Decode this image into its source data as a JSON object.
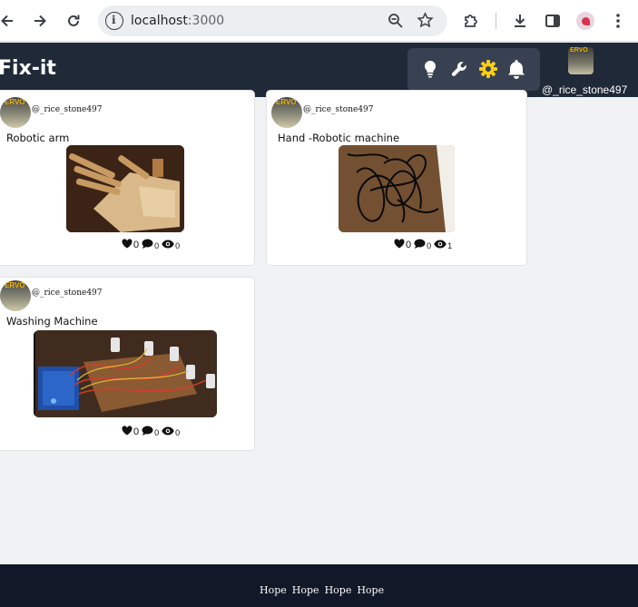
{
  "browser": {
    "url": "localhost:3000",
    "url_host": "localhost",
    "url_port": ":3000"
  },
  "app": {
    "brand": "Fix-it",
    "tools": [
      "lightbulb-icon",
      "wrench-icon",
      "gear-icon",
      "bell-icon"
    ],
    "username": "@_rice_stone497"
  },
  "posts": [
    {
      "username": "@_rice_stone497",
      "title": "Robotic arm",
      "likes": "0",
      "comments": "0",
      "views": "0",
      "image": "robotic hand prototype"
    },
    {
      "username": "@_rice_stone497",
      "title": "Hand -Robotic machine",
      "likes": "0",
      "comments": "0",
      "views": "1",
      "image": "cables on wooden table"
    },
    {
      "username": "@_rice_stone497",
      "title": "Washing Machine",
      "likes": "0",
      "comments": "0",
      "views": "0",
      "image": "arduino with servos"
    }
  ],
  "footer": {
    "links": [
      "Hope",
      "Hope",
      "Hope",
      "Hope"
    ]
  },
  "colors": {
    "header_bg": "#1f2937",
    "tools_bg": "#374151",
    "gear": "#facc15",
    "footer_bg": "#111827",
    "page_bg": "#f1f2f4"
  }
}
